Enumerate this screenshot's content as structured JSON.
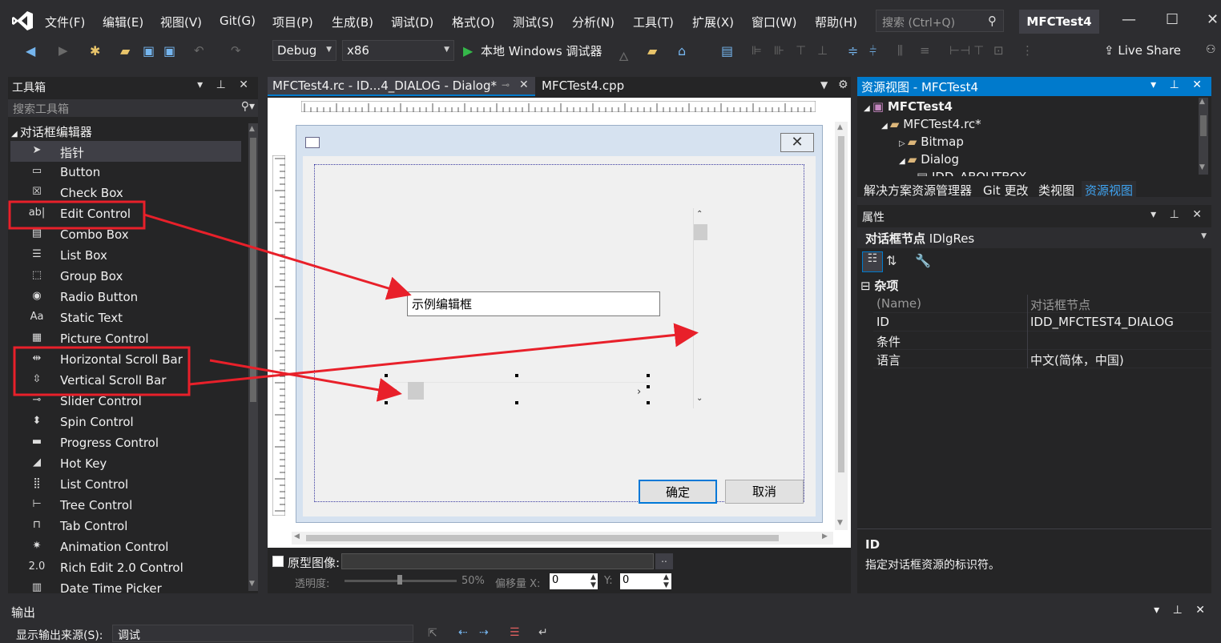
{
  "menu": [
    "文件(F)",
    "编辑(E)",
    "视图(V)",
    "Git(G)",
    "项目(P)",
    "生成(B)",
    "调试(D)",
    "格式(O)",
    "测试(S)",
    "分析(N)",
    "工具(T)",
    "扩展(X)",
    "窗口(W)",
    "帮助(H)"
  ],
  "search": {
    "placeholder": "搜索 (Ctrl+Q)"
  },
  "project_title": "MFCTest4",
  "toolbar": {
    "config": "Debug",
    "platform": "x86",
    "run_label": "本地 Windows 调试器",
    "live_share": "Live Share"
  },
  "toolbox": {
    "title": "工具箱",
    "search_placeholder": "搜索工具箱",
    "group": "对话框编辑器",
    "items": [
      {
        "icon": "pointer-icon",
        "label": "指针"
      },
      {
        "icon": "button-icon",
        "label": "Button"
      },
      {
        "icon": "checkbox-icon",
        "label": "Check Box"
      },
      {
        "icon": "edit-icon",
        "label": "Edit Control"
      },
      {
        "icon": "combo-icon",
        "label": "Combo Box"
      },
      {
        "icon": "listbox-icon",
        "label": "List Box"
      },
      {
        "icon": "groupbox-icon",
        "label": "Group Box"
      },
      {
        "icon": "radio-icon",
        "label": "Radio Button"
      },
      {
        "icon": "statictext-icon",
        "label": "Static Text"
      },
      {
        "icon": "picture-icon",
        "label": "Picture Control"
      },
      {
        "icon": "hscroll-icon",
        "label": "Horizontal Scroll Bar"
      },
      {
        "icon": "vscroll-icon",
        "label": "Vertical Scroll Bar"
      },
      {
        "icon": "slider-icon",
        "label": "Slider Control"
      },
      {
        "icon": "spin-icon",
        "label": "Spin Control"
      },
      {
        "icon": "progress-icon",
        "label": "Progress Control"
      },
      {
        "icon": "hotkey-icon",
        "label": "Hot Key"
      },
      {
        "icon": "listctrl-icon",
        "label": "List Control"
      },
      {
        "icon": "tree-icon",
        "label": "Tree Control"
      },
      {
        "icon": "tab-icon",
        "label": "Tab Control"
      },
      {
        "icon": "animation-icon",
        "label": "Animation Control"
      },
      {
        "icon": "richedit-icon",
        "label": "Rich Edit 2.0 Control"
      },
      {
        "icon": "datetime-icon",
        "label": "Date Time Picker"
      }
    ]
  },
  "editor": {
    "tabs": [
      {
        "label": "MFCTest4.rc - ID...4_DIALOG - Dialog*"
      },
      {
        "label": "MFCTest4.cpp"
      }
    ],
    "dialog": {
      "edit_text": "示例编辑框",
      "ok_label": "确定",
      "cancel_label": "取消"
    },
    "bottom": {
      "prototype_label": "原型图像:",
      "opacity_label": "透明度:",
      "opacity_value": "50%",
      "offset_label": "偏移量 X:",
      "offset_x": "0",
      "y_label": "Y:",
      "offset_y": "0",
      "browse": ".."
    }
  },
  "resource_view": {
    "title": "资源视图 - MFCTest4",
    "tree": [
      {
        "label": "MFCTest4",
        "level": 0
      },
      {
        "label": "MFCTest4.rc*",
        "level": 1
      },
      {
        "label": "Bitmap",
        "level": 2
      },
      {
        "label": "Dialog",
        "level": 2
      },
      {
        "label": "IDD_ABOUTBOX",
        "level": 3
      }
    ],
    "tabs": [
      "解决方案资源管理器",
      "Git 更改",
      "类视图",
      "资源视图"
    ]
  },
  "properties": {
    "title": "属性",
    "object": "对话框节点",
    "object_type": "IDlgRes",
    "category": "杂项",
    "rows": [
      {
        "key": "(Name)",
        "value": "对话框节点"
      },
      {
        "key": "ID",
        "value": "IDD_MFCTEST4_DIALOG"
      },
      {
        "key": "条件",
        "value": ""
      },
      {
        "key": "语言",
        "value": "中文(简体，中国)"
      }
    ],
    "desc_title": "ID",
    "desc_text": "指定对话框资源的标识符。"
  },
  "output": {
    "title": "输出",
    "source_label": "显示输出来源(S):",
    "source_value": "调试"
  },
  "colors": {
    "accent": "#007acc",
    "annotation": "#e8202a"
  }
}
